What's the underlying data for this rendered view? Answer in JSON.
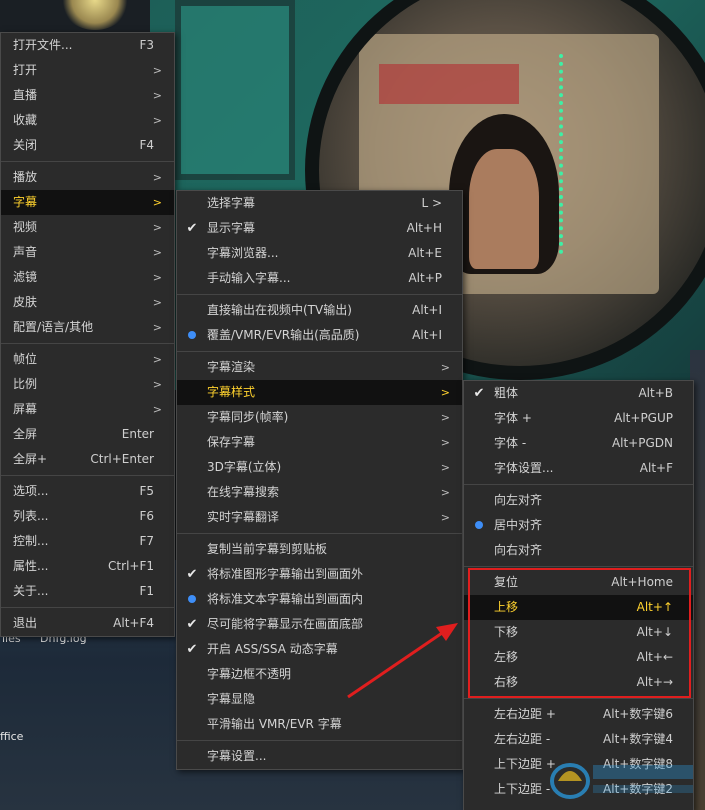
{
  "background": {
    "desktop_labels": [
      "iles",
      "Dnfg.log",
      "ffice"
    ]
  },
  "main_menu": [
    {
      "label": "打开文件...",
      "shortcut": "F3"
    },
    {
      "label": "打开",
      "arrow": ">"
    },
    {
      "label": "直播",
      "arrow": ">"
    },
    {
      "label": "收藏",
      "arrow": ">"
    },
    {
      "label": "关闭",
      "shortcut": "F4"
    },
    {
      "sep": true
    },
    {
      "label": "播放",
      "arrow": ">"
    },
    {
      "label": "字幕",
      "arrow": ">",
      "hl": true
    },
    {
      "label": "视频",
      "arrow": ">"
    },
    {
      "label": "声音",
      "arrow": ">"
    },
    {
      "label": "滤镜",
      "arrow": ">"
    },
    {
      "label": "皮肤",
      "arrow": ">"
    },
    {
      "label": "配置/语言/其他",
      "arrow": ">"
    },
    {
      "sep": true
    },
    {
      "label": "帧位",
      "arrow": ">"
    },
    {
      "label": "比例",
      "arrow": ">"
    },
    {
      "label": "屏幕",
      "arrow": ">"
    },
    {
      "label": "全屏",
      "shortcut": "Enter"
    },
    {
      "label": "全屏+",
      "shortcut": "Ctrl+Enter"
    },
    {
      "sep": true
    },
    {
      "label": "选项...",
      "shortcut": "F5"
    },
    {
      "label": "列表...",
      "shortcut": "F6"
    },
    {
      "label": "控制...",
      "shortcut": "F7"
    },
    {
      "label": "属性...",
      "shortcut": "Ctrl+F1"
    },
    {
      "label": "关于...",
      "shortcut": "F1"
    },
    {
      "sep": true
    },
    {
      "label": "退出",
      "shortcut": "Alt+F4"
    }
  ],
  "subtitle_menu": [
    {
      "label": "选择字幕",
      "shortcut": "L >"
    },
    {
      "label": "显示字幕",
      "shortcut": "Alt+H",
      "mark": "check"
    },
    {
      "label": "字幕浏览器...",
      "shortcut": "Alt+E"
    },
    {
      "label": "手动输入字幕...",
      "shortcut": "Alt+P"
    },
    {
      "sep": true
    },
    {
      "label": "直接输出在视频中(TV输出)",
      "shortcut": "Alt+I"
    },
    {
      "label": "覆盖/VMR/EVR输出(高品质)",
      "shortcut": "Alt+I",
      "mark": "dot"
    },
    {
      "sep": true
    },
    {
      "label": "字幕渲染",
      "arrow": ">"
    },
    {
      "label": "字幕样式",
      "arrow": ">",
      "hl": true
    },
    {
      "label": "字幕同步(帧率)",
      "arrow": ">"
    },
    {
      "label": "保存字幕",
      "arrow": ">"
    },
    {
      "label": "3D字幕(立体)",
      "arrow": ">"
    },
    {
      "label": "在线字幕搜索",
      "arrow": ">"
    },
    {
      "label": "实时字幕翻译",
      "arrow": ">"
    },
    {
      "sep": true
    },
    {
      "label": "复制当前字幕到剪贴板"
    },
    {
      "label": "将标准图形字幕输出到画面外",
      "mark": "check"
    },
    {
      "label": "将标准文本字幕输出到画面内",
      "mark": "dot"
    },
    {
      "label": "尽可能将字幕显示在画面底部",
      "mark": "check"
    },
    {
      "label": "开启 ASS/SSA 动态字幕",
      "mark": "check"
    },
    {
      "label": "字幕边框不透明"
    },
    {
      "label": "字幕显隐"
    },
    {
      "label": "平滑输出 VMR/EVR 字幕"
    },
    {
      "sep": true
    },
    {
      "label": "字幕设置..."
    }
  ],
  "style_menu": [
    {
      "label": "粗体",
      "shortcut": "Alt+B",
      "mark": "check"
    },
    {
      "label": "字体 +",
      "shortcut": "Alt+PGUP"
    },
    {
      "label": "字体 -",
      "shortcut": "Alt+PGDN"
    },
    {
      "label": "字体设置...",
      "shortcut": "Alt+F"
    },
    {
      "sep": true
    },
    {
      "label": "向左对齐"
    },
    {
      "label": "居中对齐",
      "mark": "dot"
    },
    {
      "label": "向右对齐"
    },
    {
      "sep": true
    },
    {
      "label": "复位",
      "shortcut": "Alt+Home"
    },
    {
      "label": "上移",
      "shortcut": "Alt+↑",
      "hl": true
    },
    {
      "label": "下移",
      "shortcut": "Alt+↓"
    },
    {
      "label": "左移",
      "shortcut": "Alt+←"
    },
    {
      "label": "右移",
      "shortcut": "Alt+→"
    },
    {
      "sep": true
    },
    {
      "label": "左右边距 +",
      "shortcut": "Alt+数字键6"
    },
    {
      "label": "左右边距 -",
      "shortcut": "Alt+数字键4"
    },
    {
      "label": "上下边距 +",
      "shortcut": "Alt+数字键8"
    },
    {
      "label": "上下边距 -",
      "shortcut": "Alt+数字键2"
    }
  ],
  "colors": {
    "menu_bg": "#2b2b2b",
    "highlight_text": "#ffd22e",
    "annotation_red": "#e01e1e",
    "radio_blue": "#3e8ef7"
  },
  "icons": {
    "check": "checkmark-icon",
    "dot": "radio-dot-icon",
    "arrow": "submenu-arrow-icon"
  }
}
